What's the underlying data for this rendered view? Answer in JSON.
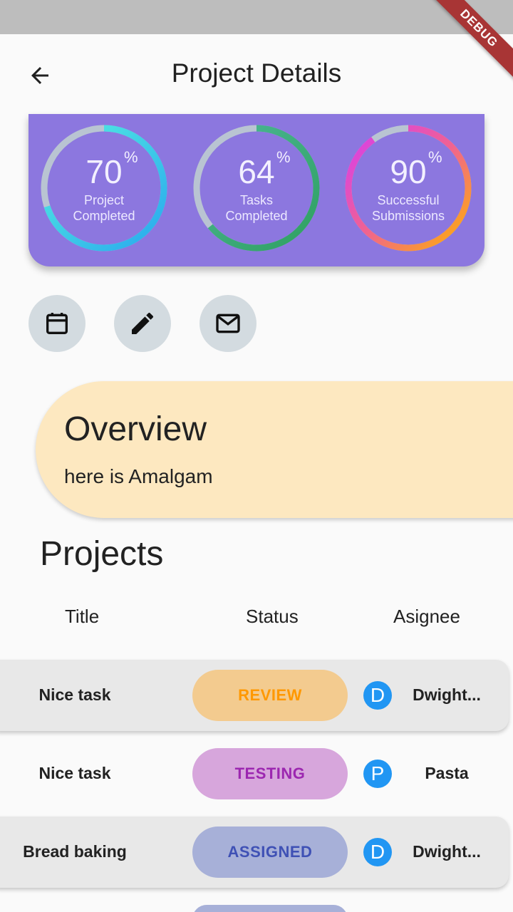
{
  "app_bar": {
    "title": "Project Details",
    "back_icon": "arrow-back-icon"
  },
  "debug_banner": "DEBUG",
  "stats": [
    {
      "value": "70",
      "unit": "%",
      "label_line1": "Project",
      "label_line2": "Completed",
      "progress": 0.7
    },
    {
      "value": "64",
      "unit": "%",
      "label_line1": "Tasks",
      "label_line2": "Completed",
      "progress": 0.64
    },
    {
      "value": "90",
      "unit": "%",
      "label_line1": "Successful",
      "label_line2": "Submissions",
      "progress": 0.9
    }
  ],
  "actions": [
    {
      "icon": "calendar-icon"
    },
    {
      "icon": "edit-icon"
    },
    {
      "icon": "mail-icon"
    }
  ],
  "overview": {
    "heading": "Overview",
    "text": "here is Amalgam"
  },
  "projects": {
    "heading": "Projects",
    "columns": [
      "Title",
      "Status",
      "Asignee"
    ],
    "rows": [
      {
        "title": "Nice task",
        "status": "REVIEW",
        "status_color": "#ff9800",
        "status_bg": "#f3cb8f",
        "avatar": "D",
        "assignee": "Dwight..."
      },
      {
        "title": "Nice task",
        "status": "TESTING",
        "status_color": "#9c27b0",
        "status_bg": "#d7a6dc",
        "avatar": "P",
        "assignee": "Pasta"
      },
      {
        "title": "Bread baking",
        "status": "ASSIGNED",
        "status_color": "#3f51b5",
        "status_bg": "#a7b0d8",
        "avatar": "D",
        "assignee": "Dwight..."
      }
    ]
  },
  "colors": {
    "card_bg": "#8c77df",
    "overview_bg": "#fde8c0",
    "action_bg": "#d3dbe0",
    "avatar_bg": "#2196f3"
  }
}
